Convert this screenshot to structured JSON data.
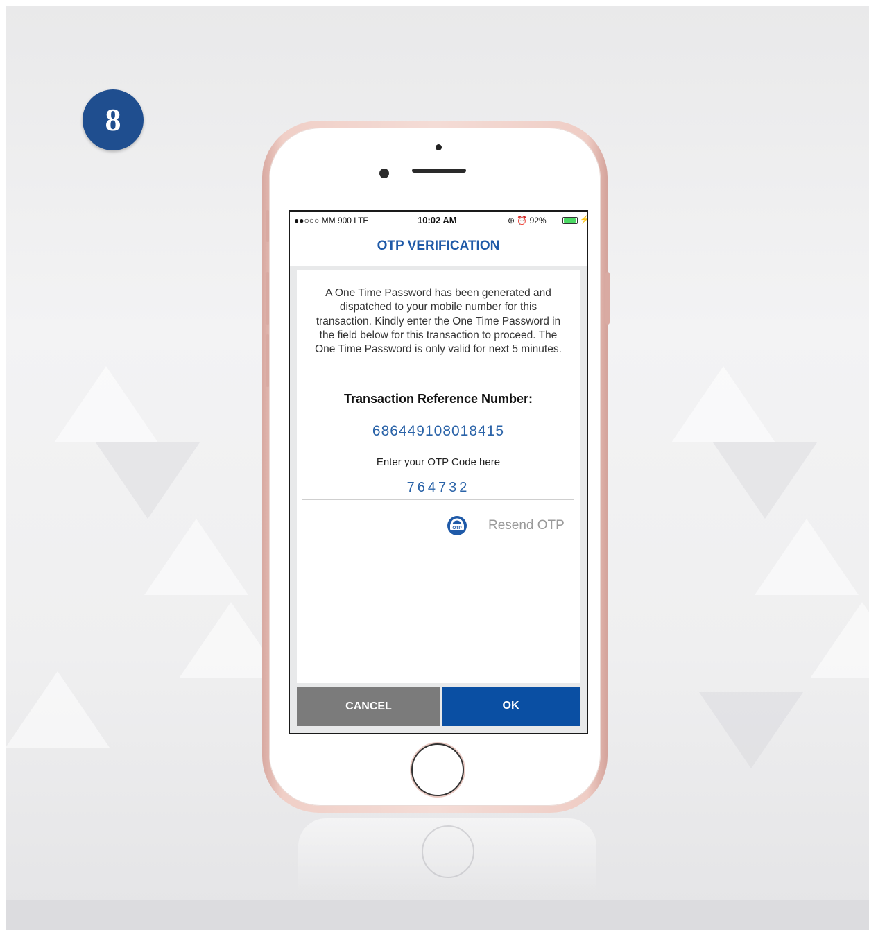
{
  "step_number": "8",
  "status_bar": {
    "carrier": "●●○○○ MM 900  LTE",
    "time": "10:02 AM",
    "indicators": "⊕ ⏰ 92%",
    "battery_percent": 92,
    "charging": true
  },
  "screen": {
    "title": "OTP VERIFICATION",
    "message": "A One Time Password has been generated and dispatched to your mobile number for this transaction. Kindly enter the One Time Password in the field below for this transaction to proceed.  The One Time Password is only valid for next 5 minutes.",
    "reference_heading": "Transaction Reference Number:",
    "reference_value": "686449108018415",
    "otp_label": "Enter your OTP Code here",
    "otp_value": "764732",
    "otp_icon_text": "OTP",
    "resend_label": "Resend OTP",
    "cancel_label": "CANCEL",
    "ok_label": "OK"
  },
  "colors": {
    "brand_blue": "#0a4fa3",
    "badge_blue": "#1f4e8f",
    "cancel_gray": "#7b7b7b",
    "link_gray": "#9a9a9a"
  }
}
